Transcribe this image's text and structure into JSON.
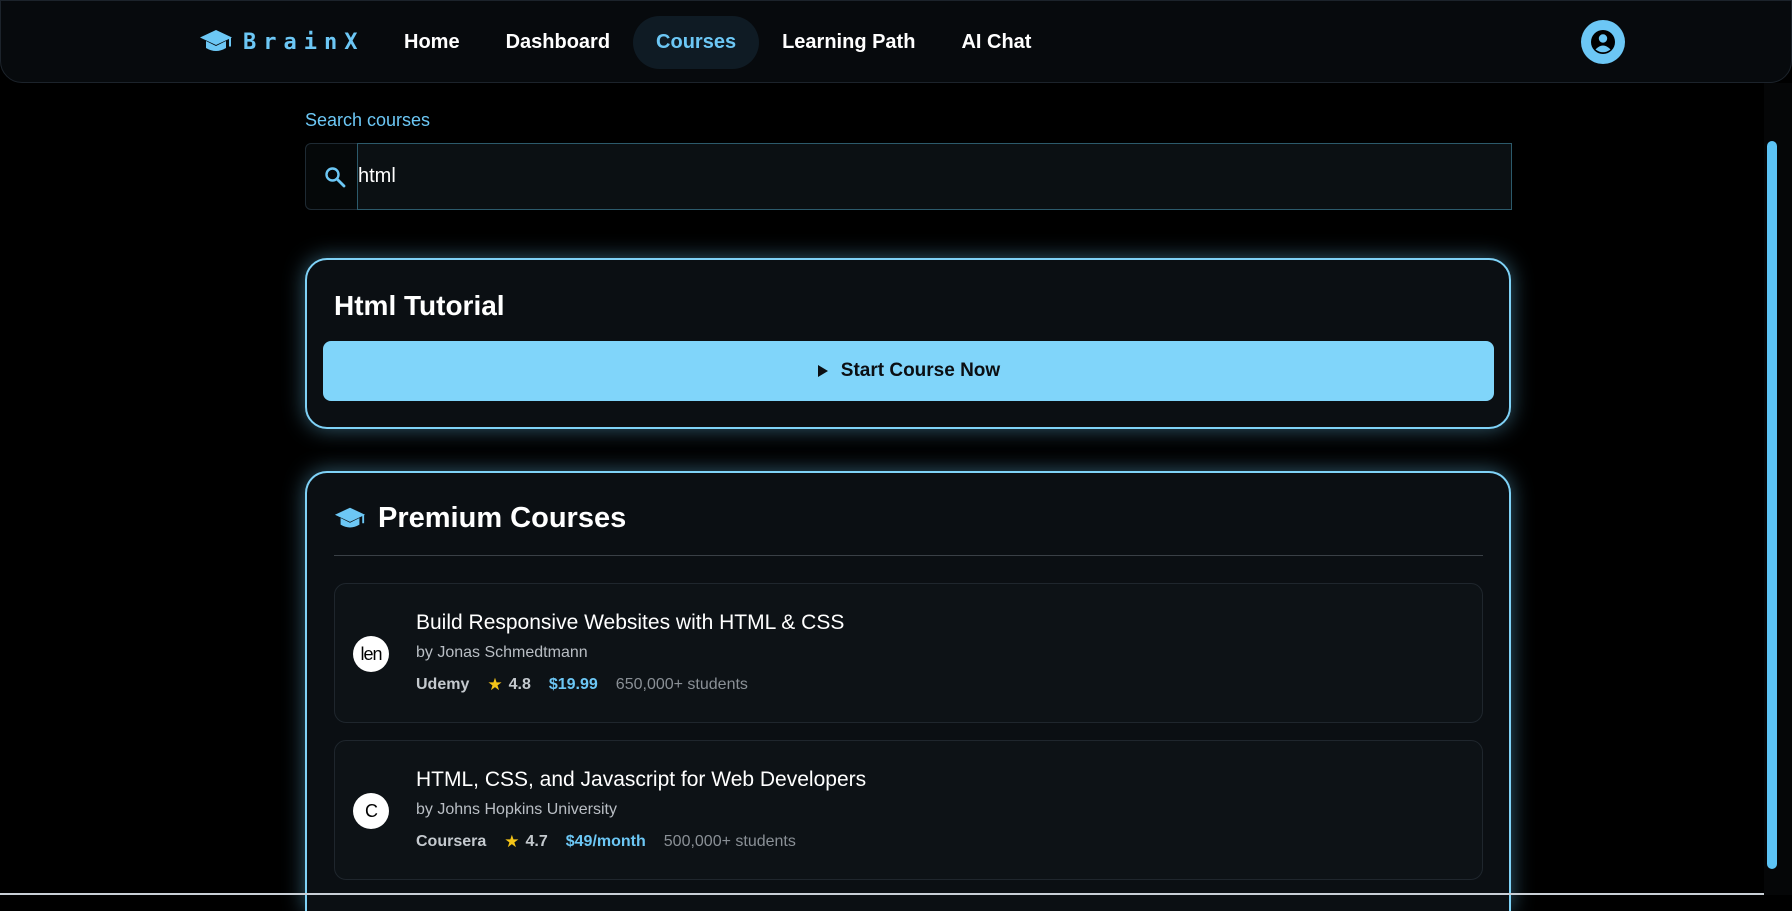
{
  "nav": {
    "brand": "BrainX",
    "brand_icon": "graduation-cap-icon",
    "links": [
      "Home",
      "Dashboard",
      "Courses",
      "Learning Path",
      "AI Chat"
    ],
    "active_link": "Courses",
    "avatar_icon": "user-avatar-icon"
  },
  "search": {
    "label": "Search courses",
    "value": "html",
    "icon": "search-icon"
  },
  "tutorial": {
    "title": "Html Tutorial",
    "button_label": "Start Course Now",
    "button_icon": "play-icon"
  },
  "premium": {
    "title": "Premium Courses",
    "icon": "graduation-cap-icon",
    "courses": [
      {
        "logo_text": "len",
        "title": "Build Responsive Websites with HTML & CSS",
        "author": "by Jonas Schmedtmann",
        "platform": "Udemy",
        "rating": "4.8",
        "price": "$19.99",
        "students": "650,000+ students"
      },
      {
        "logo_text": "C",
        "title": "HTML, CSS, and Javascript for Web Developers",
        "author": "by Johns Hopkins University",
        "platform": "Coursera",
        "rating": "4.7",
        "price": "$49/month",
        "students": "500,000+ students"
      }
    ]
  },
  "colors": {
    "accent": "#6cc7f5",
    "button": "#80d5fa",
    "star": "#f5c518",
    "background": "#000000"
  }
}
